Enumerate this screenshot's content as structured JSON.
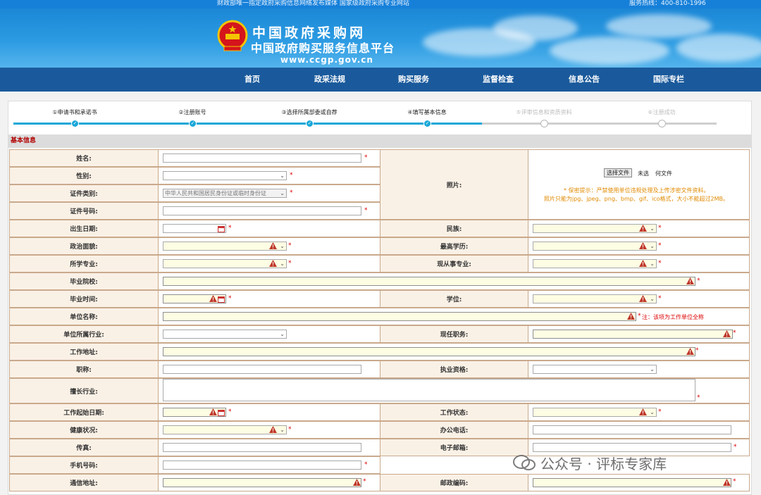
{
  "topbar": {
    "notice": "财政部唯一指定政府采购信息网络发布媒体 国家级政府采购专业网站",
    "hotline": "服务热线：400-810-1996"
  },
  "banner": {
    "title_cn": "中国政府采购网",
    "title_sub": "中国政府购买服务信息平台",
    "domain": "www.ccgp.gov.cn"
  },
  "nav": [
    "首页",
    "政采法规",
    "购买服务",
    "监督检查",
    "信息公告",
    "国际专栏"
  ],
  "steps": [
    {
      "label": "①申请书和承诺书",
      "state": "done"
    },
    {
      "label": "②注册账号",
      "state": "done"
    },
    {
      "label": "③选择所属部委或自荐",
      "state": "done"
    },
    {
      "label": "④填写基本信息",
      "state": "done"
    },
    {
      "label": "⑤评审信息和资质资料",
      "state": "pending"
    },
    {
      "label": "⑥注册成功",
      "state": "pending"
    }
  ],
  "section": {
    "title": "基本信息"
  },
  "form": {
    "name_label": "姓名:",
    "gender_label": "性别:",
    "idtype_label": "证件类别:",
    "idtype_value": "中华人民共和国居民身份证或临时身份证",
    "idno_label": "证件号码:",
    "photo_label": "照片:",
    "photo_button": "选择文件",
    "photo_status": "未选",
    "photo_nofile": "何文件",
    "photo_hint1": "* 保密提示：严禁使用单位违规处理及上传涉密文件资料。",
    "photo_hint2": "照片只能为jpg、jpeg、png、bmp、gif、ico格式，大小不能超过2MB。",
    "birth_label": "出生日期:",
    "ethnic_label": "民族:",
    "political_label": "政治面貌:",
    "edu_label": "最高学历:",
    "major_label": "所学专业:",
    "curmajor_label": "现从事专业:",
    "school_label": "毕业院校:",
    "gradtime_label": "毕业时间:",
    "degree_label": "学位:",
    "org_label": "单位名称:",
    "org_note": "注：该项为工作单位全称",
    "industry_label": "单位所属行业:",
    "post_label": "现任职务:",
    "addr_label": "工作地址:",
    "title_label": "职称:",
    "qual_label": "执业资格:",
    "speciality_label": "擅长行业:",
    "workstart_label": "工作起始日期:",
    "workstatus_label": "工作状态:",
    "health_label": "健康状况:",
    "officephone_label": "办公电话:",
    "fax_label": "传真:",
    "email_label": "电子邮箱:",
    "mobile_label": "手机号码:",
    "mailaddr_label": "通信地址:",
    "zip_label": "邮政编码:",
    "required_mark": "*"
  },
  "watermark": "公众号 · 评标专家库",
  "colors": {
    "nav": "#1a5a9c",
    "step_done": "#1aa7d8",
    "label_bg": "#faf1e6",
    "required": "#dd0000"
  }
}
